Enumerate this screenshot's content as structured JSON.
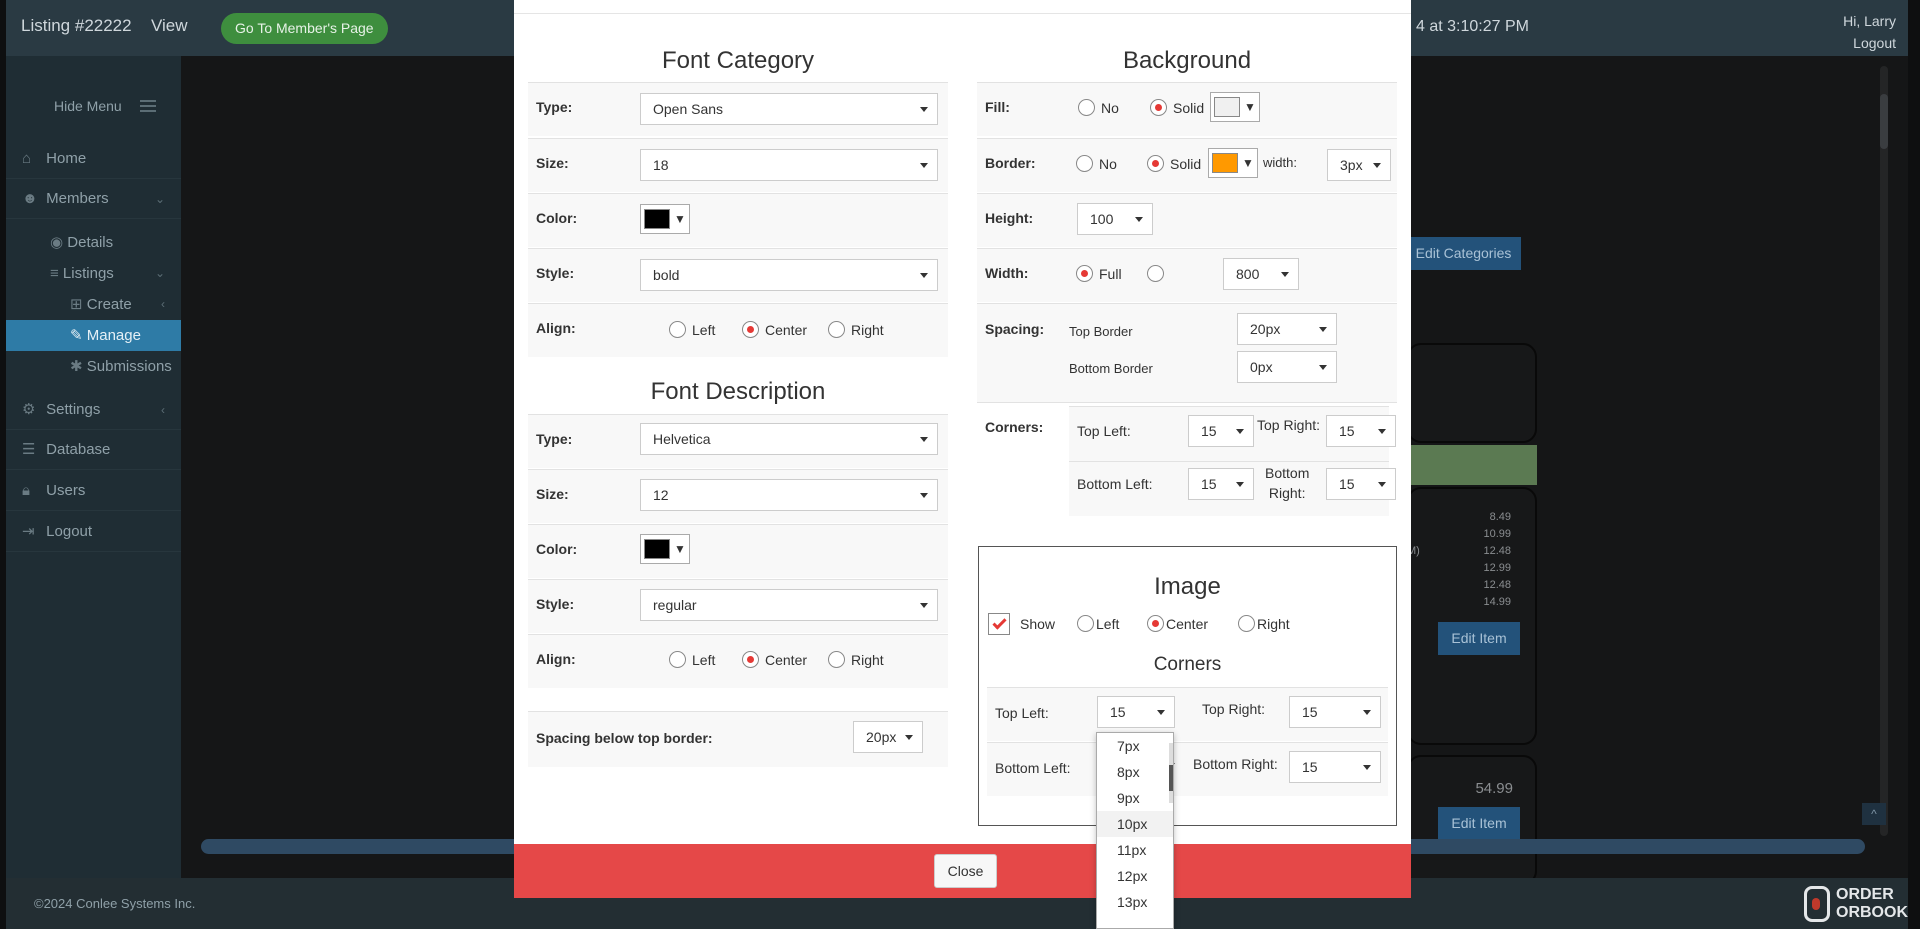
{
  "header": {
    "listing_label": "Listing #22222",
    "view_label": "View",
    "member_button": "Go To Member's Page",
    "datetime_partial": "4 at 3:10:27 PM",
    "greeting": "Hi, Larry",
    "logout": "Logout"
  },
  "sidebar": {
    "hide_menu": "Hide Menu",
    "items": [
      {
        "label": "Home"
      },
      {
        "label": "Members"
      },
      {
        "label": "Details"
      },
      {
        "label": "Listings"
      },
      {
        "label": "Create"
      },
      {
        "label": "Manage"
      },
      {
        "label": "Submissions"
      },
      {
        "label": "Settings"
      },
      {
        "label": "Database"
      },
      {
        "label": "Users"
      },
      {
        "label": "Logout"
      }
    ]
  },
  "background": {
    "edit_categories": "Edit Categories",
    "edit_item": "Edit Item",
    "prices": [
      "8.49",
      "10.99",
      "12.48",
      "12.99",
      "12.48",
      "14.99"
    ],
    "big_price": "54.99",
    "paren_fragments": [
      "M)",
      ")"
    ]
  },
  "footer": {
    "copyright": "©2024 Conlee Systems Inc.",
    "logo_top": "ORDER",
    "logo_bottom": "ORBOOK",
    "back_to_top": "^"
  },
  "modal": {
    "font_category": {
      "title": "Font Category",
      "type_label": "Type:",
      "type_value": "Open Sans",
      "size_label": "Size:",
      "size_value": "18",
      "color_label": "Color:",
      "color_value": "#000000",
      "style_label": "Style:",
      "style_value": "bold",
      "align_label": "Align:",
      "align_options": [
        "Left",
        "Center",
        "Right"
      ],
      "align_selected": "Center"
    },
    "font_description": {
      "title": "Font Description",
      "type_label": "Type:",
      "type_value": "Helvetica",
      "size_label": "Size:",
      "size_value": "12",
      "color_label": "Color:",
      "color_value": "#000000",
      "style_label": "Style:",
      "style_value": "regular",
      "align_label": "Align:",
      "align_options": [
        "Left",
        "Center",
        "Right"
      ],
      "align_selected": "Center"
    },
    "spacing_below": {
      "label": "Spacing below top border:",
      "value": "20px"
    },
    "background": {
      "title": "Background",
      "fill_label": "Fill:",
      "fill_no": "No",
      "fill_solid": "Solid",
      "fill_color": "#f0f0f0",
      "border_label": "Border:",
      "border_no": "No",
      "border_solid": "Solid",
      "border_color": "#ff9900",
      "width_small_label": "width:",
      "border_width": "3px",
      "height_label": "Height:",
      "height_value": "100",
      "width_label": "Width:",
      "width_full": "Full",
      "width_value": "800",
      "spacing_label": "Spacing:",
      "top_border_label": "Top Border",
      "top_border_value": "20px",
      "bottom_border_label": "Bottom Border",
      "bottom_border_value": "0px",
      "corners_label": "Corners:",
      "top_left_label": "Top Left:",
      "top_left_value": "15",
      "top_right_label": "Top Right:",
      "top_right_value": "15",
      "bottom_left_label": "Bottom Left:",
      "bottom_left_value": "15",
      "bottom_right_label_1": "Bottom",
      "bottom_right_label_2": "Right:",
      "bottom_right_value": "15"
    },
    "image": {
      "title": "Image",
      "show_label": "Show",
      "align_options": [
        "Left",
        "Center",
        "Right"
      ],
      "align_selected": "Center",
      "corners_title": "Corners",
      "top_left_label": "Top Left:",
      "top_left_value": "15",
      "top_right_label": "Top Right:",
      "top_right_value": "15",
      "bottom_left_label": "Bottom Left:",
      "bottom_right_label": "Bottom Right:",
      "bottom_right_value": "15"
    },
    "close": "Close"
  },
  "dropdown_options": [
    "7px",
    "8px",
    "9px",
    "10px",
    "11px",
    "12px",
    "13px"
  ],
  "dropdown_highlight": "10px"
}
